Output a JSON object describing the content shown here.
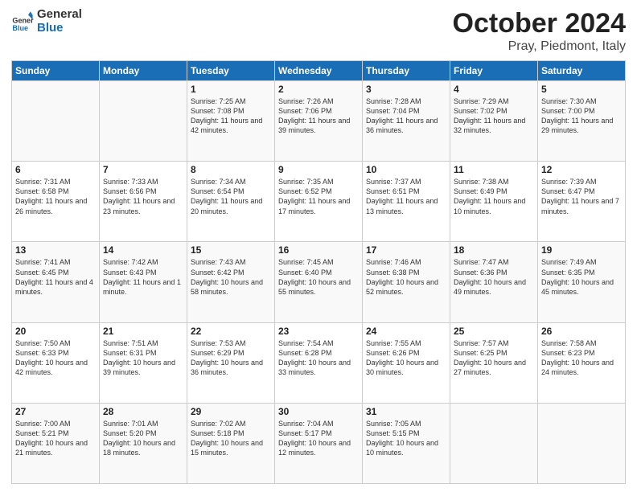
{
  "header": {
    "logo_general": "General",
    "logo_blue": "Blue",
    "title": "October 2024",
    "location": "Pray, Piedmont, Italy"
  },
  "days_of_week": [
    "Sunday",
    "Monday",
    "Tuesday",
    "Wednesday",
    "Thursday",
    "Friday",
    "Saturday"
  ],
  "weeks": [
    [
      {
        "day": "",
        "sunrise": "",
        "sunset": "",
        "daylight": ""
      },
      {
        "day": "",
        "sunrise": "",
        "sunset": "",
        "daylight": ""
      },
      {
        "day": "1",
        "sunrise": "Sunrise: 7:25 AM",
        "sunset": "Sunset: 7:08 PM",
        "daylight": "Daylight: 11 hours and 42 minutes."
      },
      {
        "day": "2",
        "sunrise": "Sunrise: 7:26 AM",
        "sunset": "Sunset: 7:06 PM",
        "daylight": "Daylight: 11 hours and 39 minutes."
      },
      {
        "day": "3",
        "sunrise": "Sunrise: 7:28 AM",
        "sunset": "Sunset: 7:04 PM",
        "daylight": "Daylight: 11 hours and 36 minutes."
      },
      {
        "day": "4",
        "sunrise": "Sunrise: 7:29 AM",
        "sunset": "Sunset: 7:02 PM",
        "daylight": "Daylight: 11 hours and 32 minutes."
      },
      {
        "day": "5",
        "sunrise": "Sunrise: 7:30 AM",
        "sunset": "Sunset: 7:00 PM",
        "daylight": "Daylight: 11 hours and 29 minutes."
      }
    ],
    [
      {
        "day": "6",
        "sunrise": "Sunrise: 7:31 AM",
        "sunset": "Sunset: 6:58 PM",
        "daylight": "Daylight: 11 hours and 26 minutes."
      },
      {
        "day": "7",
        "sunrise": "Sunrise: 7:33 AM",
        "sunset": "Sunset: 6:56 PM",
        "daylight": "Daylight: 11 hours and 23 minutes."
      },
      {
        "day": "8",
        "sunrise": "Sunrise: 7:34 AM",
        "sunset": "Sunset: 6:54 PM",
        "daylight": "Daylight: 11 hours and 20 minutes."
      },
      {
        "day": "9",
        "sunrise": "Sunrise: 7:35 AM",
        "sunset": "Sunset: 6:52 PM",
        "daylight": "Daylight: 11 hours and 17 minutes."
      },
      {
        "day": "10",
        "sunrise": "Sunrise: 7:37 AM",
        "sunset": "Sunset: 6:51 PM",
        "daylight": "Daylight: 11 hours and 13 minutes."
      },
      {
        "day": "11",
        "sunrise": "Sunrise: 7:38 AM",
        "sunset": "Sunset: 6:49 PM",
        "daylight": "Daylight: 11 hours and 10 minutes."
      },
      {
        "day": "12",
        "sunrise": "Sunrise: 7:39 AM",
        "sunset": "Sunset: 6:47 PM",
        "daylight": "Daylight: 11 hours and 7 minutes."
      }
    ],
    [
      {
        "day": "13",
        "sunrise": "Sunrise: 7:41 AM",
        "sunset": "Sunset: 6:45 PM",
        "daylight": "Daylight: 11 hours and 4 minutes."
      },
      {
        "day": "14",
        "sunrise": "Sunrise: 7:42 AM",
        "sunset": "Sunset: 6:43 PM",
        "daylight": "Daylight: 11 hours and 1 minute."
      },
      {
        "day": "15",
        "sunrise": "Sunrise: 7:43 AM",
        "sunset": "Sunset: 6:42 PM",
        "daylight": "Daylight: 10 hours and 58 minutes."
      },
      {
        "day": "16",
        "sunrise": "Sunrise: 7:45 AM",
        "sunset": "Sunset: 6:40 PM",
        "daylight": "Daylight: 10 hours and 55 minutes."
      },
      {
        "day": "17",
        "sunrise": "Sunrise: 7:46 AM",
        "sunset": "Sunset: 6:38 PM",
        "daylight": "Daylight: 10 hours and 52 minutes."
      },
      {
        "day": "18",
        "sunrise": "Sunrise: 7:47 AM",
        "sunset": "Sunset: 6:36 PM",
        "daylight": "Daylight: 10 hours and 49 minutes."
      },
      {
        "day": "19",
        "sunrise": "Sunrise: 7:49 AM",
        "sunset": "Sunset: 6:35 PM",
        "daylight": "Daylight: 10 hours and 45 minutes."
      }
    ],
    [
      {
        "day": "20",
        "sunrise": "Sunrise: 7:50 AM",
        "sunset": "Sunset: 6:33 PM",
        "daylight": "Daylight: 10 hours and 42 minutes."
      },
      {
        "day": "21",
        "sunrise": "Sunrise: 7:51 AM",
        "sunset": "Sunset: 6:31 PM",
        "daylight": "Daylight: 10 hours and 39 minutes."
      },
      {
        "day": "22",
        "sunrise": "Sunrise: 7:53 AM",
        "sunset": "Sunset: 6:29 PM",
        "daylight": "Daylight: 10 hours and 36 minutes."
      },
      {
        "day": "23",
        "sunrise": "Sunrise: 7:54 AM",
        "sunset": "Sunset: 6:28 PM",
        "daylight": "Daylight: 10 hours and 33 minutes."
      },
      {
        "day": "24",
        "sunrise": "Sunrise: 7:55 AM",
        "sunset": "Sunset: 6:26 PM",
        "daylight": "Daylight: 10 hours and 30 minutes."
      },
      {
        "day": "25",
        "sunrise": "Sunrise: 7:57 AM",
        "sunset": "Sunset: 6:25 PM",
        "daylight": "Daylight: 10 hours and 27 minutes."
      },
      {
        "day": "26",
        "sunrise": "Sunrise: 7:58 AM",
        "sunset": "Sunset: 6:23 PM",
        "daylight": "Daylight: 10 hours and 24 minutes."
      }
    ],
    [
      {
        "day": "27",
        "sunrise": "Sunrise: 7:00 AM",
        "sunset": "Sunset: 5:21 PM",
        "daylight": "Daylight: 10 hours and 21 minutes."
      },
      {
        "day": "28",
        "sunrise": "Sunrise: 7:01 AM",
        "sunset": "Sunset: 5:20 PM",
        "daylight": "Daylight: 10 hours and 18 minutes."
      },
      {
        "day": "29",
        "sunrise": "Sunrise: 7:02 AM",
        "sunset": "Sunset: 5:18 PM",
        "daylight": "Daylight: 10 hours and 15 minutes."
      },
      {
        "day": "30",
        "sunrise": "Sunrise: 7:04 AM",
        "sunset": "Sunset: 5:17 PM",
        "daylight": "Daylight: 10 hours and 12 minutes."
      },
      {
        "day": "31",
        "sunrise": "Sunrise: 7:05 AM",
        "sunset": "Sunset: 5:15 PM",
        "daylight": "Daylight: 10 hours and 10 minutes."
      },
      {
        "day": "",
        "sunrise": "",
        "sunset": "",
        "daylight": ""
      },
      {
        "day": "",
        "sunrise": "",
        "sunset": "",
        "daylight": ""
      }
    ]
  ]
}
